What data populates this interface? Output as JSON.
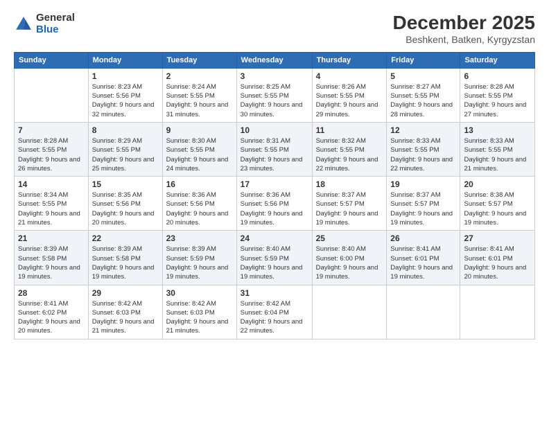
{
  "header": {
    "logo_line1": "General",
    "logo_line2": "Blue",
    "month": "December 2025",
    "location": "Beshkent, Batken, Kyrgyzstan"
  },
  "days_of_week": [
    "Sunday",
    "Monday",
    "Tuesday",
    "Wednesday",
    "Thursday",
    "Friday",
    "Saturday"
  ],
  "weeks": [
    [
      {
        "day": null
      },
      {
        "day": "1",
        "sunrise": "8:23 AM",
        "sunset": "5:56 PM",
        "daylight": "9 hours and 32 minutes."
      },
      {
        "day": "2",
        "sunrise": "8:24 AM",
        "sunset": "5:55 PM",
        "daylight": "9 hours and 31 minutes."
      },
      {
        "day": "3",
        "sunrise": "8:25 AM",
        "sunset": "5:55 PM",
        "daylight": "9 hours and 30 minutes."
      },
      {
        "day": "4",
        "sunrise": "8:26 AM",
        "sunset": "5:55 PM",
        "daylight": "9 hours and 29 minutes."
      },
      {
        "day": "5",
        "sunrise": "8:27 AM",
        "sunset": "5:55 PM",
        "daylight": "9 hours and 28 minutes."
      },
      {
        "day": "6",
        "sunrise": "8:28 AM",
        "sunset": "5:55 PM",
        "daylight": "9 hours and 27 minutes."
      }
    ],
    [
      {
        "day": "7",
        "sunrise": "8:28 AM",
        "sunset": "5:55 PM",
        "daylight": "9 hours and 26 minutes."
      },
      {
        "day": "8",
        "sunrise": "8:29 AM",
        "sunset": "5:55 PM",
        "daylight": "9 hours and 25 minutes."
      },
      {
        "day": "9",
        "sunrise": "8:30 AM",
        "sunset": "5:55 PM",
        "daylight": "9 hours and 24 minutes."
      },
      {
        "day": "10",
        "sunrise": "8:31 AM",
        "sunset": "5:55 PM",
        "daylight": "9 hours and 23 minutes."
      },
      {
        "day": "11",
        "sunrise": "8:32 AM",
        "sunset": "5:55 PM",
        "daylight": "9 hours and 22 minutes."
      },
      {
        "day": "12",
        "sunrise": "8:33 AM",
        "sunset": "5:55 PM",
        "daylight": "9 hours and 22 minutes."
      },
      {
        "day": "13",
        "sunrise": "8:33 AM",
        "sunset": "5:55 PM",
        "daylight": "9 hours and 21 minutes."
      }
    ],
    [
      {
        "day": "14",
        "sunrise": "8:34 AM",
        "sunset": "5:55 PM",
        "daylight": "9 hours and 21 minutes."
      },
      {
        "day": "15",
        "sunrise": "8:35 AM",
        "sunset": "5:56 PM",
        "daylight": "9 hours and 20 minutes."
      },
      {
        "day": "16",
        "sunrise": "8:36 AM",
        "sunset": "5:56 PM",
        "daylight": "9 hours and 20 minutes."
      },
      {
        "day": "17",
        "sunrise": "8:36 AM",
        "sunset": "5:56 PM",
        "daylight": "9 hours and 19 minutes."
      },
      {
        "day": "18",
        "sunrise": "8:37 AM",
        "sunset": "5:57 PM",
        "daylight": "9 hours and 19 minutes."
      },
      {
        "day": "19",
        "sunrise": "8:37 AM",
        "sunset": "5:57 PM",
        "daylight": "9 hours and 19 minutes."
      },
      {
        "day": "20",
        "sunrise": "8:38 AM",
        "sunset": "5:57 PM",
        "daylight": "9 hours and 19 minutes."
      }
    ],
    [
      {
        "day": "21",
        "sunrise": "8:39 AM",
        "sunset": "5:58 PM",
        "daylight": "9 hours and 19 minutes."
      },
      {
        "day": "22",
        "sunrise": "8:39 AM",
        "sunset": "5:58 PM",
        "daylight": "9 hours and 19 minutes."
      },
      {
        "day": "23",
        "sunrise": "8:39 AM",
        "sunset": "5:59 PM",
        "daylight": "9 hours and 19 minutes."
      },
      {
        "day": "24",
        "sunrise": "8:40 AM",
        "sunset": "5:59 PM",
        "daylight": "9 hours and 19 minutes."
      },
      {
        "day": "25",
        "sunrise": "8:40 AM",
        "sunset": "6:00 PM",
        "daylight": "9 hours and 19 minutes."
      },
      {
        "day": "26",
        "sunrise": "8:41 AM",
        "sunset": "6:01 PM",
        "daylight": "9 hours and 19 minutes."
      },
      {
        "day": "27",
        "sunrise": "8:41 AM",
        "sunset": "6:01 PM",
        "daylight": "9 hours and 20 minutes."
      }
    ],
    [
      {
        "day": "28",
        "sunrise": "8:41 AM",
        "sunset": "6:02 PM",
        "daylight": "9 hours and 20 minutes."
      },
      {
        "day": "29",
        "sunrise": "8:42 AM",
        "sunset": "6:03 PM",
        "daylight": "9 hours and 21 minutes."
      },
      {
        "day": "30",
        "sunrise": "8:42 AM",
        "sunset": "6:03 PM",
        "daylight": "9 hours and 21 minutes."
      },
      {
        "day": "31",
        "sunrise": "8:42 AM",
        "sunset": "6:04 PM",
        "daylight": "9 hours and 22 minutes."
      },
      {
        "day": null
      },
      {
        "day": null
      },
      {
        "day": null
      }
    ]
  ]
}
